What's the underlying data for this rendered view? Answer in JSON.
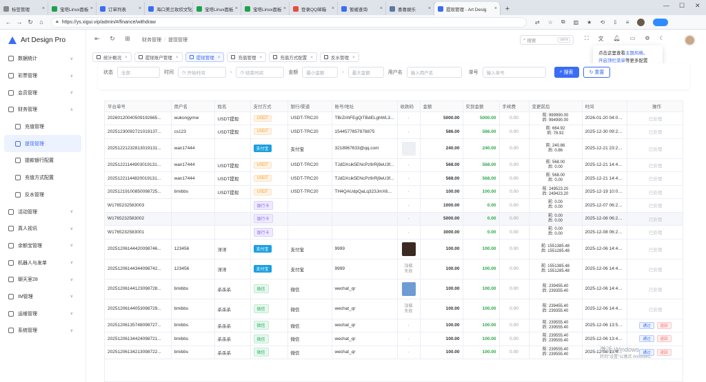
{
  "browser": {
    "tabs": [
      {
        "label": "标签管理",
        "color": "#888888"
      },
      {
        "label": "宝塔Linux面板",
        "color": "#21a04c"
      },
      {
        "label": "订单列表",
        "color": "#3b6cf5"
      },
      {
        "label": "海口美兰玫欣文化传媒",
        "color": "#3b6cf5"
      },
      {
        "label": "宝塔Linux面板",
        "color": "#21a04c"
      },
      {
        "label": "宝塔Linux面板",
        "color": "#21a04c"
      },
      {
        "label": "登录QQ邮箱",
        "color": "#e74c3c"
      },
      {
        "label": "暂缓查询",
        "color": "#3b6cf5"
      },
      {
        "label": "喜喜娱乐",
        "color": "#5a78a0"
      },
      {
        "label": "提现管理 - Art Desig",
        "color": "#3b6cf5",
        "active": true
      }
    ],
    "url": "https://ys.xigui.vip/admin/#/finance/withdraw"
  },
  "app": {
    "name": "Art Design Pro"
  },
  "sidebar": {
    "items": [
      {
        "label": "数据统计",
        "arrow": "∨",
        "type": "top"
      },
      {
        "label": "彩票管理",
        "arrow": "∨",
        "type": "top"
      },
      {
        "label": "会员管理",
        "arrow": "∨",
        "type": "top"
      },
      {
        "label": "财务管理",
        "arrow": "∧",
        "type": "top"
      },
      {
        "label": "充值管理",
        "type": "sub"
      },
      {
        "label": "提现管理",
        "type": "sub",
        "active": true
      },
      {
        "label": "提款银行配置",
        "type": "sub"
      },
      {
        "label": "充值方式配置",
        "type": "sub"
      },
      {
        "label": "反水管理",
        "type": "sub"
      },
      {
        "label": "活动管理",
        "arrow": "∨",
        "type": "top"
      },
      {
        "label": "真人视讯",
        "arrow": "∨",
        "type": "top"
      },
      {
        "label": "余额宝管理",
        "arrow": "∨",
        "type": "top"
      },
      {
        "label": "机器人与发单",
        "arrow": "∨",
        "type": "top"
      },
      {
        "label": "聊天室28",
        "arrow": "∨",
        "type": "top"
      },
      {
        "label": "IM管理",
        "arrow": "∨",
        "type": "top"
      },
      {
        "label": "运维管理",
        "arrow": "∨",
        "type": "top"
      },
      {
        "label": "系统管理",
        "arrow": "∨",
        "type": "top"
      }
    ]
  },
  "header": {
    "breadcrumb": [
      "财务管理",
      "提现管理"
    ],
    "search_placeholder": "搜索",
    "search_key": "ctrl k"
  },
  "tooltip": {
    "prefix": "点击这里查看",
    "link1": "主题风格",
    "mid": "、",
    "link2": "开启顶栏菜单",
    "suffix": "等更多配置"
  },
  "worktabs": [
    "统计概况",
    "提现账户管理",
    "提现管理",
    "充值管理",
    "充值方式配置",
    "反水管理"
  ],
  "filter": {
    "status_label": "状态",
    "status_value": "全部",
    "time_label": "时间",
    "start_ph": "开始时间",
    "dash": "-",
    "end_ph": "结束时间",
    "amount_label": "金额",
    "min_ph": "最小金额",
    "max_ph": "最大金额",
    "user_label": "用户名",
    "user_ph": "输入用户名",
    "order_label": "单号",
    "order_ph": "输入单号",
    "search_btn": "搜索",
    "reset_btn": "重置"
  },
  "table": {
    "headers": [
      "平台单号",
      "用户名",
      "姓名",
      "支付方式",
      "银行/渠道",
      "账号/地址",
      "收款码",
      "金额",
      "实到金额",
      "手续费",
      "变更前后",
      "时间",
      "操作"
    ],
    "rows": [
      {
        "order": "20260120040509192665...",
        "user": "wukongymw",
        "name": "USDT提现",
        "pay": "USDT",
        "payType": "usdt",
        "bank": "USDT-TRC20",
        "account": "TBrZrihFEgQiTBdELghWL3...",
        "qr": "-",
        "amount": "5000.00",
        "actual": "5000.00",
        "fee": "0.00",
        "before": "前: 999990.00",
        "after": "后: 994990.00",
        "time": "2026-01-20 04:05:09",
        "op": "已处理"
      },
      {
        "order": "20251230092721019137...",
        "user": "cs123",
        "name": "USDT提现",
        "pay": "USDT",
        "payType": "usdt",
        "bank": "USDT-TRC20",
        "account": "1544577857878875",
        "qr": "-",
        "amount": "586.00",
        "actual": "586.00",
        "fee": "0.00",
        "before": "前: 664.92",
        "after": "后: 78.92",
        "time": "2025-12-30 09:27:21",
        "op": "已处理"
      },
      {
        "order": "20251221232813019131...",
        "user": "wan17444",
        "name": "",
        "pay": "支付宝",
        "payType": "alipay",
        "bank": "支付宝",
        "account": "3218967633@qq.com",
        "qr": "img-blank",
        "amount": "240.00",
        "actual": "240.00",
        "fee": "0.00",
        "before": "前: 240.86",
        "after": "后: 0.86",
        "time": "2025-12-21 23:28:13",
        "op": "已处理",
        "tall": true
      },
      {
        "order": "20251221144903019131...",
        "user": "wan17444",
        "name": "USDT提现",
        "pay": "USDT",
        "payType": "usdt",
        "bank": "USDT-TRC20",
        "account": "TJdDXcik5ENcPz9rRj9eU3f...",
        "qr": "-",
        "amount": "568.00",
        "actual": "568.00",
        "fee": "0.00",
        "before": "前: 568.00",
        "after": "后: 0.00",
        "time": "2025-12-21 14:49:03",
        "op": "已处理"
      },
      {
        "order": "20251221144820019131...",
        "user": "wan17444",
        "name": "USDT提现",
        "pay": "USDT",
        "payType": "usdt",
        "bank": "USDT-TRC20",
        "account": "TJdDXcik5ENcPz9rRj9eU3f...",
        "qr": "-",
        "amount": "568.00",
        "actual": "568.00",
        "fee": "0.00",
        "before": "前: 568.00",
        "after": "后: 0.00",
        "time": "2025-12-21 14:48:20",
        "op": "已处理"
      },
      {
        "order": "20251219100850098725...",
        "user": "timibbs",
        "name": "USDT提现",
        "pay": "USDT",
        "payType": "usdt",
        "bank": "USDT-TRC20",
        "account": "TH4QAUdpQaLq323JmX6...",
        "qr": "-",
        "amount": "100.00",
        "actual": "100.00",
        "fee": "0.00",
        "before": "前: 249523.20",
        "after": "后: 249423.20",
        "time": "2025-12-19 10:08:50",
        "op": "已处理"
      },
      {
        "order": "W1765232583003",
        "user": "",
        "name": "",
        "pay": "银行卡",
        "payType": "bank",
        "bank": "",
        "account": "",
        "qr": "-",
        "amount": "1000.00",
        "actual": "0.00",
        "fee": "0.00",
        "before": "前: 0.00",
        "after": "后: 0.00",
        "time": "2025-12-07 06:23:03",
        "op": "已处理"
      },
      {
        "order": "W1765232583002",
        "user": "",
        "name": "",
        "pay": "银行卡",
        "payType": "bank",
        "bank": "",
        "account": "",
        "qr": "-",
        "amount": "5000.00",
        "actual": "0.00",
        "fee": "0.00",
        "before": "前: 0.00",
        "after": "后: 0.00",
        "time": "2025-12-08 06:23:03",
        "op": "已处理",
        "hl": true
      },
      {
        "order": "W1765232583001",
        "user": "",
        "name": "",
        "pay": "银行卡",
        "payType": "bank",
        "bank": "",
        "account": "",
        "qr": "-",
        "amount": "3000.00",
        "actual": "0.00",
        "fee": "0.00",
        "before": "前: 0.00",
        "after": "后: 0.00",
        "time": "2025-12-08 06:23:03",
        "op": "已处理"
      },
      {
        "order": "20251206144420098746...",
        "user": "123456",
        "name": "洋洋",
        "pay": "支付宝",
        "payType": "alipay",
        "bank": "支付宝",
        "account": "9999",
        "qr": "img-dark",
        "amount": "100.00",
        "actual": "100.00",
        "fee": "0.00",
        "before": "前: 1551385.48",
        "after": "后: 1551285.48",
        "time": "2025-12-06 14:44:20",
        "op": "已处理",
        "tall": true
      },
      {
        "order": "20251206144344098742...",
        "user": "123456",
        "name": "洋洋",
        "pay": "支付宝",
        "payType": "alipay",
        "bank": "支付宝",
        "account": "9999",
        "qr": "加载失败",
        "amount": "100.00",
        "actual": "100.00",
        "fee": "0.00",
        "before": "前: 1551385.48",
        "after": "后: 1551285.48",
        "time": "2025-12-06 14:43:44",
        "op": "已处理",
        "tall": true
      },
      {
        "order": "20251206144123098728...",
        "user": "timibbs",
        "name": "杀杀杀",
        "pay": "微信",
        "payType": "wx",
        "bank": "微信",
        "account": "wechat_qr",
        "qr": "img-blue",
        "amount": "100.00",
        "actual": "100.00",
        "fee": "0.00",
        "before": "前: 239455.40",
        "after": "后: 239355.40",
        "time": "2025-12-06 14:41:23",
        "op": "已处理",
        "tall": true
      },
      {
        "order": "20251206144053098729...",
        "user": "timibbs",
        "name": "杀杀杀",
        "pay": "微信",
        "payType": "wx",
        "bank": "微信",
        "account": "wechat_qr",
        "qr": "加载失败",
        "amount": "100.00",
        "actual": "100.00",
        "fee": "0.00",
        "before": "前: 239455.40",
        "after": "后: 239355.40",
        "time": "2025-12-06 14:40:53",
        "op": "已处理",
        "tall": true
      },
      {
        "order": "20251206135748098727...",
        "user": "timibbs",
        "name": "杀杀杀",
        "pay": "微信",
        "payType": "wx",
        "bank": "微信",
        "account": "wechat_qr",
        "qr": "-",
        "amount": "100.00",
        "actual": "100.00",
        "fee": "0.00",
        "before": "前: 239555.40",
        "after": "后: 239555.40",
        "time": "2025-12-06 13:57:48",
        "op": "actions"
      },
      {
        "order": "20251206134424098721...",
        "user": "timibbs",
        "name": "杀杀杀",
        "pay": "微信",
        "payType": "wx",
        "bank": "微信",
        "account": "wechat_qr",
        "qr": "-",
        "amount": "100.00",
        "actual": "100.00",
        "fee": "0.00",
        "before": "前: 239555.40",
        "after": "后: 239555.40",
        "time": "2025-12-06 13:44:24",
        "op": "actions"
      },
      {
        "order": "20251206134213098722...",
        "user": "timibbs",
        "name": "杀杀杀",
        "pay": "微信",
        "payType": "wx",
        "bank": "微信",
        "account": "wechat_qr",
        "qr": "-",
        "amount": "100.00",
        "actual": "100.00",
        "fee": "0.00",
        "before": "前: 239555.40",
        "after": "后: 239555.40",
        "time": "2025-12-08 13:42:13",
        "op": "actions"
      }
    ],
    "approve_label": "通过",
    "reject_label": "退回"
  },
  "watermark": {
    "line1": "激活 Windows",
    "line2": "转到\"设置\"以激活 Windows。"
  }
}
